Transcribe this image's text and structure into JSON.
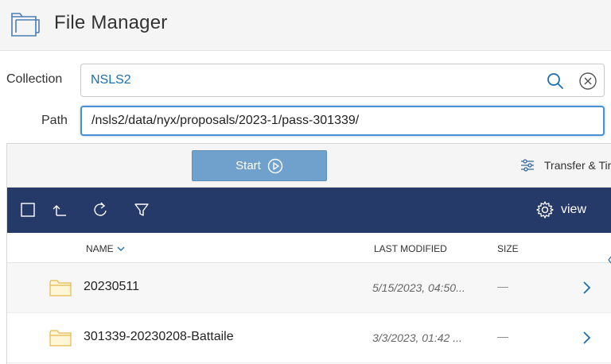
{
  "header": {
    "title": "File Manager"
  },
  "collection": {
    "label": "Collection",
    "value": "NSLS2"
  },
  "path": {
    "label": "Path",
    "value": "/nsls2/data/nyx/proposals/2023-1/pass-301339/"
  },
  "actions": {
    "start_label": "Start",
    "transfer_label": "Transfer & Timer"
  },
  "toolbar": {
    "view_label": "view"
  },
  "table": {
    "columns": {
      "name": "NAME",
      "modified": "LAST MODIFIED",
      "size": "SIZE"
    },
    "rows": [
      {
        "name": "20230511",
        "modified": "5/15/2023, 04:50...",
        "size": "—"
      },
      {
        "name": "301339-20230208-Battaile",
        "modified": "3/3/2023, 01:42 ...",
        "size": "—"
      }
    ]
  },
  "colors": {
    "navbar": "#253a69",
    "accent": "#1a6fb0",
    "start_button": "#6fa1cc"
  },
  "icons": [
    "folder-icon",
    "search-icon",
    "clear-icon",
    "play-icon",
    "sliders-icon",
    "checkbox-icon",
    "up-folder-icon",
    "refresh-icon",
    "filter-icon",
    "gear-icon",
    "chevron-down-icon",
    "chevron-right-icon"
  ]
}
